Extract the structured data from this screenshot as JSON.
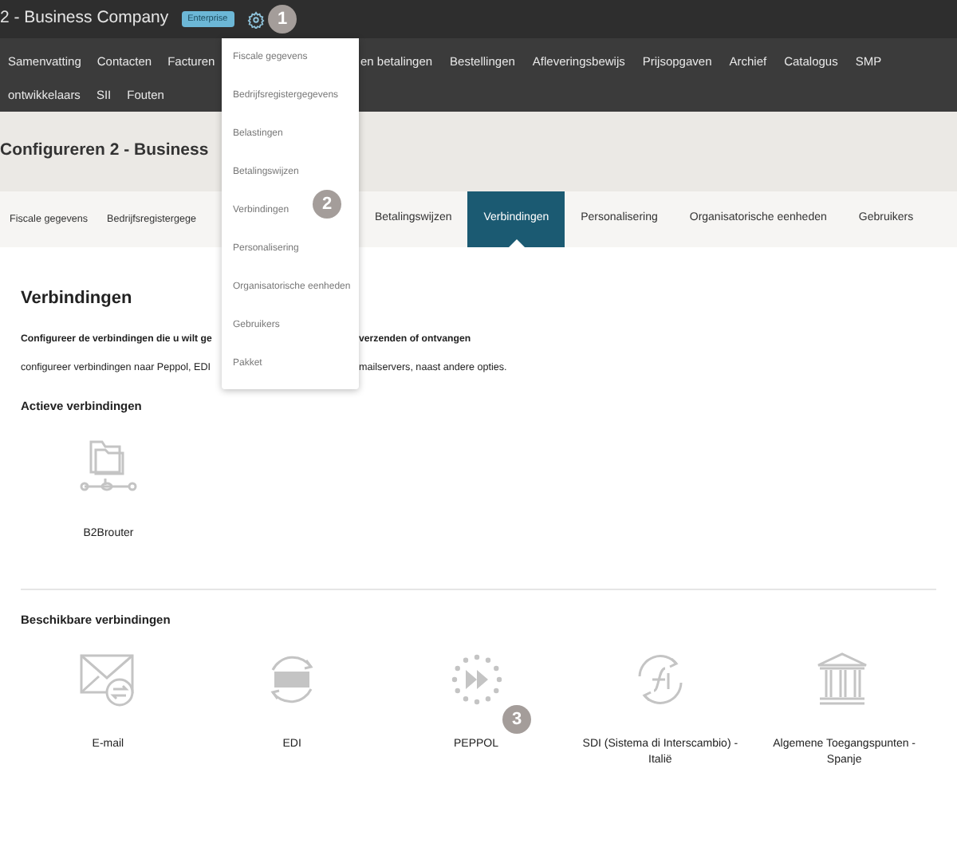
{
  "header": {
    "title": "2 - Business Company",
    "badge": "Enterprise"
  },
  "callouts": [
    "1",
    "2",
    "3"
  ],
  "nav": {
    "row1_left": [
      "Samenvatting",
      "Contacten",
      "Facturen"
    ],
    "row1_right": [
      "en betalingen",
      "Bestellingen",
      "Afleveringsbewijs",
      "Prijsopgaven",
      "Archief",
      "Catalogus",
      "SMP"
    ],
    "row2": [
      "ontwikkelaars",
      "SII",
      "Fouten"
    ]
  },
  "settings_menu": [
    "Fiscale gegevens",
    "Bedrijfsregistergegevens",
    "Belastingen",
    "Betalingswijzen",
    "Verbindingen",
    "Personalisering",
    "Organisatorische eenheden",
    "Gebruikers",
    "Pakket"
  ],
  "page_title": "Configureren 2 - Business",
  "tabs_left": [
    {
      "label": "Fiscale gegevens",
      "selected": false
    },
    {
      "label": "Bedrijfsregistergege",
      "selected": false
    }
  ],
  "tabs_right": [
    {
      "label": "Betalingswijzen",
      "selected": false
    },
    {
      "label": "Verbindingen",
      "selected": true
    },
    {
      "label": "Personalisering",
      "selected": false
    },
    {
      "label": "Organisatorische eenheden",
      "selected": false
    },
    {
      "label": "Gebruikers",
      "selected": false
    }
  ],
  "section": {
    "title": "Verbindingen",
    "intro_left": "Configureer de verbindingen die u wilt ge",
    "intro_right": "verzenden of ontvangen",
    "desc_left": "configureer verbindingen naar Peppol, EDI",
    "desc_right": "mailservers, naast andere opties."
  },
  "active": {
    "title": "Actieve verbindingen",
    "items": [
      {
        "kind": "router",
        "label": "B2Brouter"
      }
    ]
  },
  "available": {
    "title": "Beschikbare verbindingen",
    "items": [
      {
        "kind": "email",
        "label": "E-mail"
      },
      {
        "kind": "edi",
        "label": "EDI"
      },
      {
        "kind": "peppol",
        "label": "PEPPOL"
      },
      {
        "kind": "sdi",
        "label": "SDI (Sistema di Interscambio) - Italië"
      },
      {
        "kind": "spain",
        "label": "Algemene Toegangspunten - Spanje"
      }
    ]
  }
}
